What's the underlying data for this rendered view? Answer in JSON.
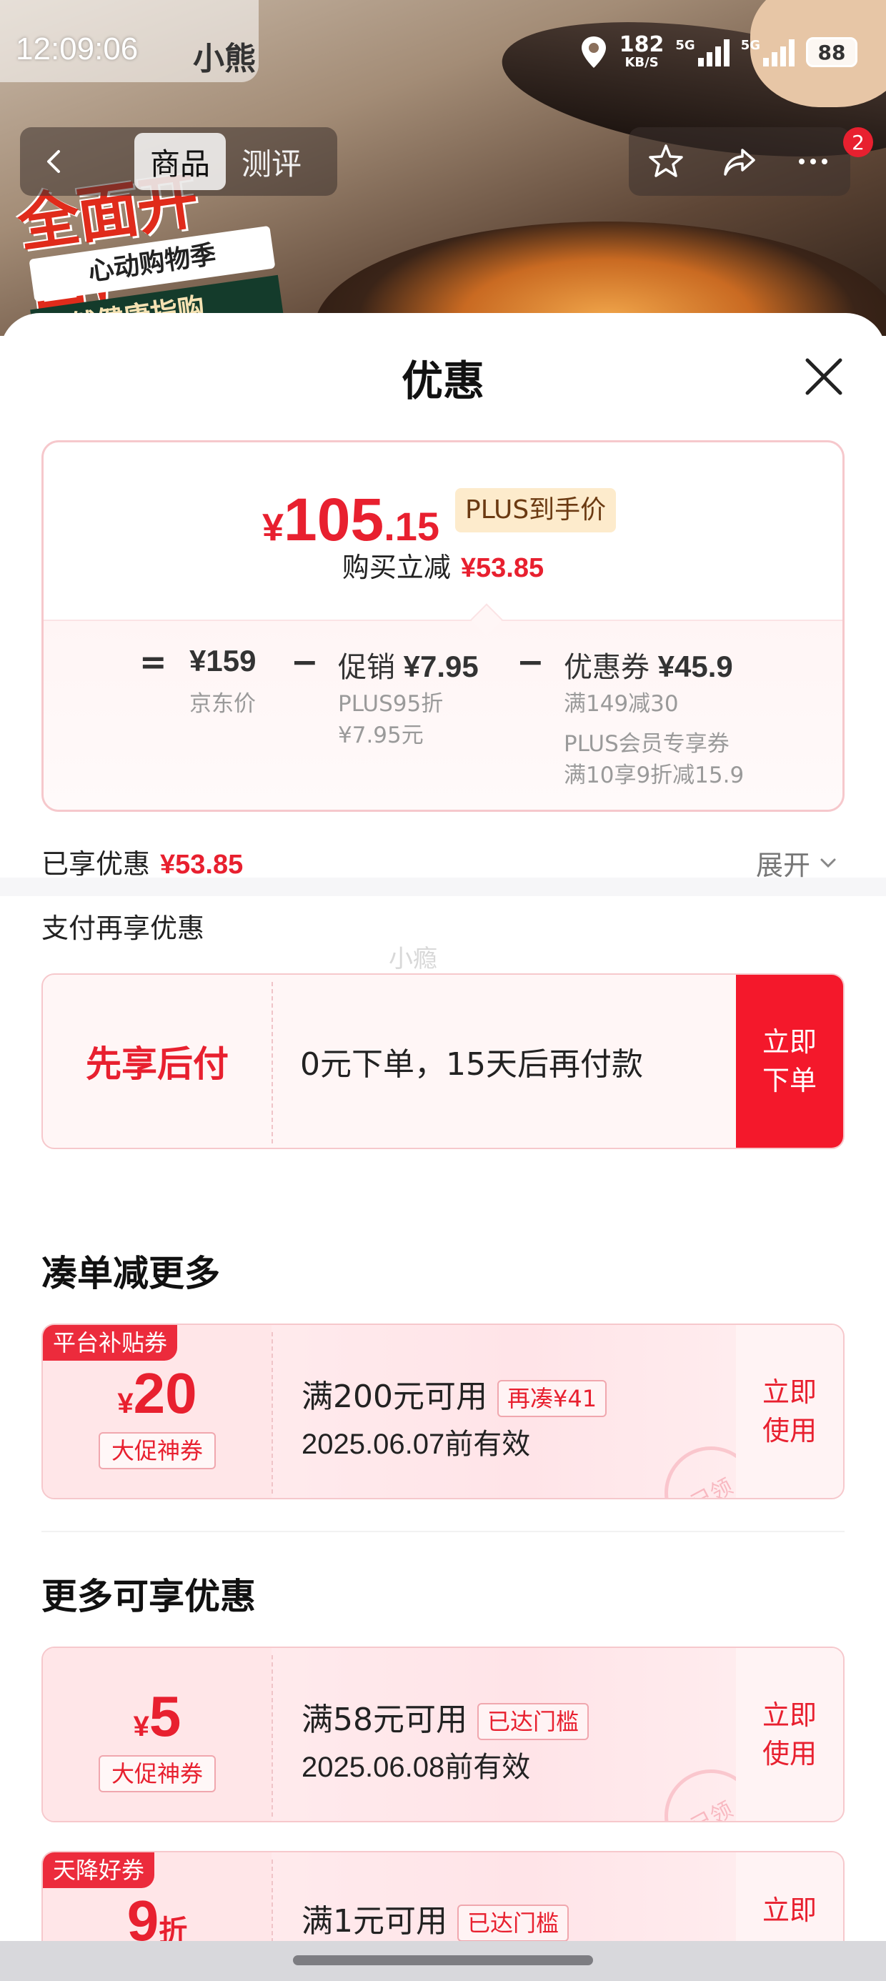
{
  "status_bar": {
    "time": "12:09:06",
    "app_name": "小熊",
    "speed_value": "182",
    "speed_unit": "KB/S",
    "net1": "5G",
    "net2": "5G",
    "battery": "88"
  },
  "nav": {
    "tabs": [
      {
        "label": "商品",
        "active": true
      },
      {
        "label": "测评",
        "active": false
      }
    ],
    "cart_badge": "2"
  },
  "promo_banner": {
    "line1": "全面开启!",
    "line2": "心动购物季",
    "line3": "天然健康指购"
  },
  "sheet": {
    "title": "优惠",
    "price_card": {
      "currency": "¥",
      "price_int": "105",
      "price_dec": ".15",
      "plus_tag": "PLUS到手价",
      "cut_label": "购买立减",
      "cut_amount": "¥53.85",
      "breakdown": {
        "eq": "=",
        "jd_price": "¥159",
        "jd_label": "京东价",
        "minus1": "−",
        "promo_label": "促销",
        "promo_amount": "¥7.95",
        "promo_sub1": "PLUS95折",
        "promo_sub2": "¥7.95元",
        "minus2": "−",
        "coupon_label": "优惠券",
        "coupon_amount": "¥45.9",
        "coupon_sub1": "满149减30",
        "coupon_sub2": "PLUS会员专享券",
        "coupon_sub3": "满10享9折减15.9"
      }
    },
    "enjoyed_label": "已享优惠",
    "enjoyed_amount": "¥53.85",
    "expand_label": "展开",
    "pay_section_title": "支付再享优惠",
    "watermark": "小瘾",
    "pay_later": {
      "title": "先享后付",
      "desc": "0元下单，15天后再付款",
      "btn_line1": "立即",
      "btn_line2": "下单"
    },
    "section_more_discount": "凑单减更多",
    "coupon1": {
      "tag": "平台补贴券",
      "currency": "¥",
      "amount": "20",
      "type": "大促神券",
      "condition": "满200元可用",
      "chip": "再凑¥41",
      "expiry": "2025.06.07前有效",
      "btn_line1": "立即",
      "btn_line2": "使用",
      "stamp": "已领"
    },
    "section_more_available": "更多可享优惠",
    "coupon2": {
      "currency": "¥",
      "amount": "5",
      "type": "大促神券",
      "condition": "满58元可用",
      "chip": "已达门槛",
      "expiry": "2025.06.08前有效",
      "btn_line1": "立即",
      "btn_line2": "使用",
      "stamp": "已领"
    },
    "coupon3": {
      "tag": "天降好券",
      "amount": "9",
      "unit": "折",
      "condition": "满1元可用",
      "chip": "已达门槛",
      "btn_line1": "立即"
    }
  },
  "colors": {
    "accent_red": "#e8202f",
    "button_red": "#f4182b",
    "plus_tag_bg": "#fdebcc",
    "coupon_border": "#f6c8cc"
  }
}
